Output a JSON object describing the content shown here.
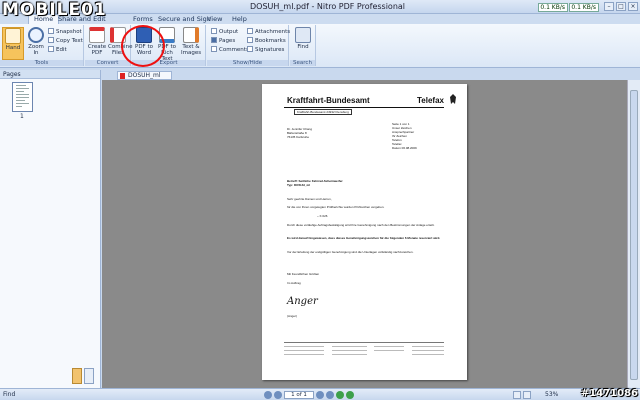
{
  "watermark": {
    "logo_text": "MOBILE01",
    "id_text": "#1471086"
  },
  "window": {
    "title": "DOSUH_ml.pdf - Nitro PDF Professional",
    "net_up": "0.1 KB/s",
    "net_down": "0.1 KB/s"
  },
  "menu_tabs": [
    "Home",
    "Share and Edit",
    "Forms",
    "Secure and Sign",
    "View",
    "Help"
  ],
  "ribbon": {
    "tools": {
      "label": "Tools",
      "hand": "Hand",
      "zoom": "Zoom In",
      "snapshot": "Snapshot",
      "copy_text": "Copy Text",
      "edit": "Edit"
    },
    "convert": {
      "label": "Convert",
      "create_pdf": "Create PDF",
      "combine": "Combine Files"
    },
    "export": {
      "label": "Export",
      "pdf_to_word": "PDF to Word",
      "pdf_to_rich": "PDF to Rich Text",
      "text_images": "Text & Images"
    },
    "showhide": {
      "label": "Show/Hide",
      "output": "Output",
      "pages": "Pages",
      "comments": "Comments",
      "attachments": "Attachments",
      "bookmarks": "Bookmarks",
      "signatures": "Signatures"
    },
    "search": {
      "label": "Search",
      "find": "Find"
    }
  },
  "left_panel": {
    "title": "Pages",
    "page_number": "1"
  },
  "doc_tab": "DOSUH_ml",
  "document": {
    "title": "Kraftfahrt-Bundesamt",
    "telefax": "Telefax",
    "subtitle": "Kraftfahrt-Bundesamt 24932 Flensburg",
    "address": [
      "Dr. Jennifer Chang",
      "Bärlenstraße 8",
      "76135 Karlsruhe"
    ],
    "meta": [
      "Seite 1 von 1",
      "Unser Zeichen",
      "Ansprechpartner",
      "Ihr Zeichen",
      "Telefon",
      "Telefax",
      "Datum 06.08.2009"
    ],
    "subject_label": "Betreff:",
    "subject": "Seitliche Fahrrad-Scheinwerfer",
    "type_label": "Typ:",
    "type": "DOSUH_ml",
    "greeting": "Sehr geehrte Damen und Herren,",
    "para1": "für die von Ihnen vorgelegten Prüfberichte wurden Prüfzeichen vergeben.",
    "mark": "~ K 026",
    "para2": "Durch diese vorläufige Auftragsbestätigung wird Ihre Genehmigung nach den Bestimmungen der Anlage erteilt.",
    "para3": "Es wird darauf hingewiesen, dass dieses Genehmigungszeichen für die folgenden 6 Monate reserviert wird.",
    "para4": "Vor der Erteilung der endgültigen Genehmigung sind die Unterlagen vollständig nachzureichen.",
    "closing": "Mit freundlichen Grüßen",
    "closing2": "Im Auftrag",
    "signer": "(Anger)"
  },
  "status": {
    "find": "Find",
    "page_box": "1 of 1",
    "zoom": "53%"
  }
}
